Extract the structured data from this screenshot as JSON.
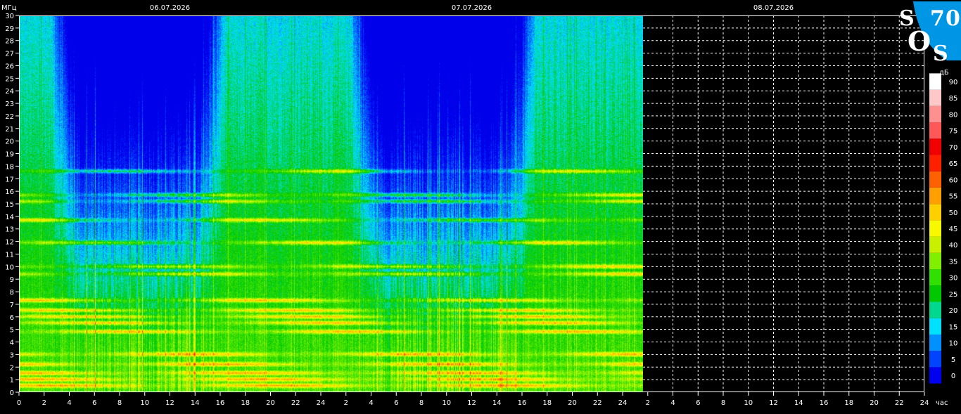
{
  "chart_data": {
    "type": "heatmap",
    "y_unit_label": "МГц",
    "x_unit_label": "час",
    "colorbar_unit_label": "дБ",
    "date_labels": [
      "06.07.2026",
      "07.07.2026",
      "08.07.2026"
    ],
    "y_ticks": [
      0,
      1,
      2,
      3,
      4,
      5,
      6,
      7,
      8,
      9,
      10,
      11,
      12,
      13,
      14,
      15,
      16,
      17,
      18,
      19,
      20,
      21,
      22,
      23,
      24,
      25,
      26,
      27,
      28,
      29,
      30
    ],
    "ylim": [
      0,
      30
    ],
    "x_tick_labels": [
      "0",
      "2",
      "4",
      "6",
      "8",
      "10",
      "12",
      "14",
      "16",
      "18",
      "20",
      "22",
      "24",
      "2",
      "4",
      "6",
      "8",
      "10",
      "12",
      "14",
      "16",
      "18",
      "20",
      "22",
      "24",
      "2",
      "4",
      "6",
      "8",
      "10",
      "12",
      "14",
      "16",
      "18",
      "20",
      "22",
      "24"
    ],
    "x_range_hours": [
      0,
      72
    ],
    "data_extent_hours": [
      0,
      50
    ],
    "grid": "dashed-white-in-empty-region",
    "colorbar_ticks": [
      0,
      5,
      10,
      15,
      20,
      25,
      30,
      35,
      40,
      45,
      50,
      55,
      60,
      65,
      70,
      75,
      80,
      85,
      90
    ],
    "colorbar_colors": [
      "#0000f0",
      "#0044ff",
      "#0090ff",
      "#00e0ff",
      "#00d890",
      "#00c800",
      "#30e000",
      "#80f000",
      "#c8f000",
      "#f8f800",
      "#ffd000",
      "#ffa000",
      "#ff6000",
      "#ff2000",
      "#f00000",
      "#ff5858",
      "#ff9090",
      "#ffc8c8",
      "#ffffff"
    ],
    "bands_mhz": [
      0.5,
      1.0,
      1.5,
      2.2,
      3.0,
      4.8,
      5.5,
      6.0,
      6.5,
      7.3,
      9.4,
      10.0,
      11.9,
      13.7,
      15.2,
      15.7,
      17.6
    ],
    "quiet_periods_hours": [
      [
        4,
        15
      ],
      [
        28,
        40
      ]
    ]
  },
  "logo": {
    "letters": [
      "S",
      "7",
      "0",
      "O",
      "S"
    ],
    "bg_color": "#0096e6"
  }
}
